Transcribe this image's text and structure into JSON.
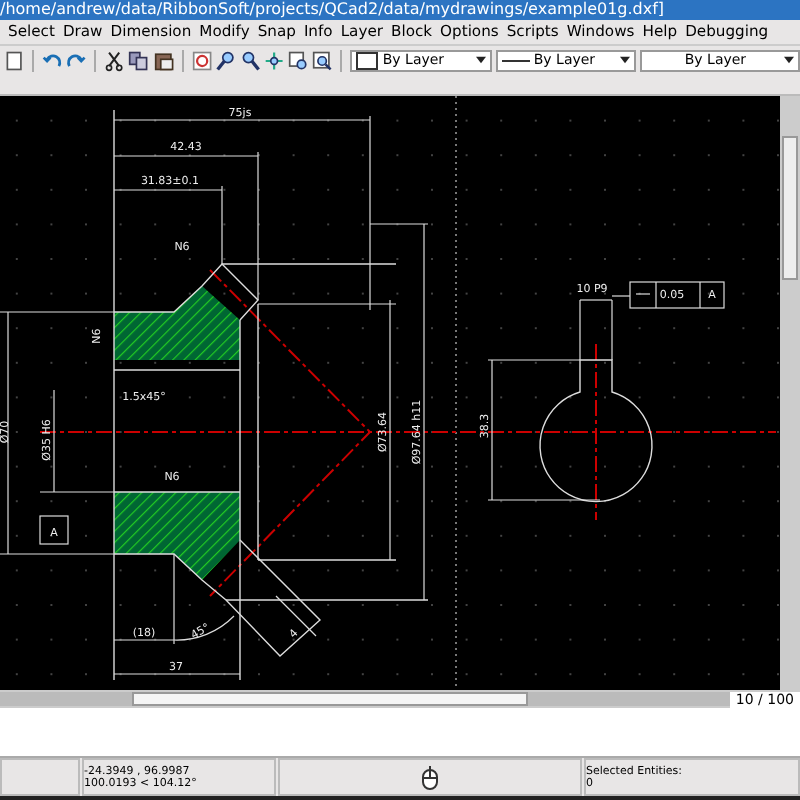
{
  "window": {
    "title": "/home/andrew/data/RibbonSoft/projects/QCad2/data/mydrawings/example01g.dxf]"
  },
  "menu": [
    "Select",
    "Draw",
    "Dimension",
    "Modify",
    "Snap",
    "Info",
    "Layer",
    "Block",
    "Options",
    "Scripts",
    "Windows",
    "Help",
    "Debugging"
  ],
  "toolbar": {
    "color_combo": "By Layer",
    "linetype_combo": "By Layer",
    "width_combo": "By Layer"
  },
  "drawing": {
    "labels": [
      "75js",
      "42.43",
      "31.83±0.1",
      "N6",
      "N6",
      "1.5x45°",
      "Ø70",
      "Ø35 H6",
      "A",
      "N6",
      "Ø73.64",
      "Ø97.64 h11",
      "(18)",
      "45°",
      "37",
      "4",
      "10 P9",
      "0.05",
      "A",
      "38.3"
    ]
  },
  "horizontal_scrollbar": {
    "page": "10 / 100"
  },
  "status_bar": {
    "coordinates_absolute": "-24.3949 , 96.9987",
    "coordinates_polar": "100.0193 < 104.12°",
    "selected_label": "Selected Entities:",
    "selected_count": "0"
  }
}
